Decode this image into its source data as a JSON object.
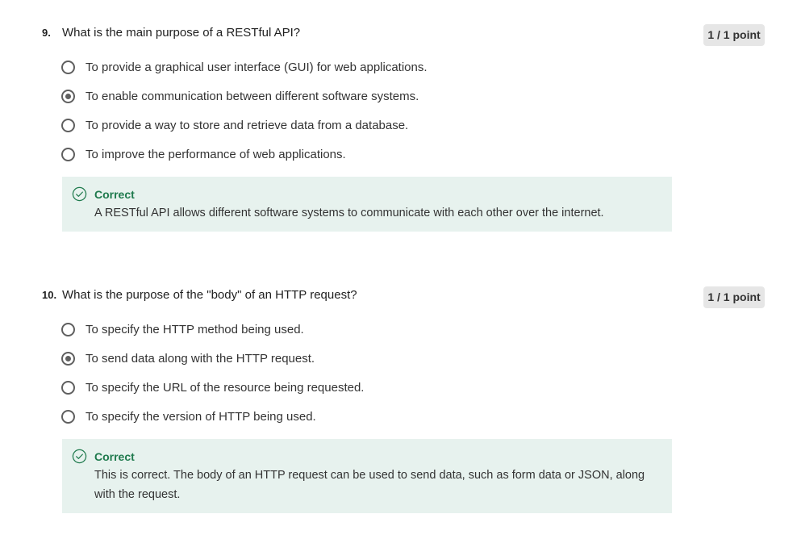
{
  "questions": [
    {
      "number": "9.",
      "text": "What is the main purpose of a RESTful API?",
      "points": "1 / 1 point",
      "options": [
        {
          "label": "To provide a graphical user interface (GUI) for web applications.",
          "selected": false
        },
        {
          "label": "To enable communication between different software systems.",
          "selected": true
        },
        {
          "label": "To provide a way to store and retrieve data from a database.",
          "selected": false
        },
        {
          "label": "To improve the performance of web applications.",
          "selected": false
        }
      ],
      "feedback": {
        "status": "Correct",
        "text": "A RESTful API allows different software systems to communicate with each other over the internet."
      }
    },
    {
      "number": "10.",
      "text": "What is the purpose of the \"body\" of an HTTP request?",
      "points": "1 / 1 point",
      "options": [
        {
          "label": "To specify the HTTP method being used.",
          "selected": false
        },
        {
          "label": "To send data along with the HTTP request.",
          "selected": true
        },
        {
          "label": "To specify the URL of the resource being requested.",
          "selected": false
        },
        {
          "label": "To specify the version of HTTP being used.",
          "selected": false
        }
      ],
      "feedback": {
        "status": "Correct",
        "text": "This is correct. The body of an HTTP request can be used to send data, such as form data or JSON, along with the request."
      }
    }
  ],
  "colors": {
    "correct_green": "#1f7a4d",
    "feedback_bg": "#e7f2ee",
    "points_bg": "#e6e6e6"
  },
  "icons": {
    "feedback": "check-circle-icon"
  }
}
